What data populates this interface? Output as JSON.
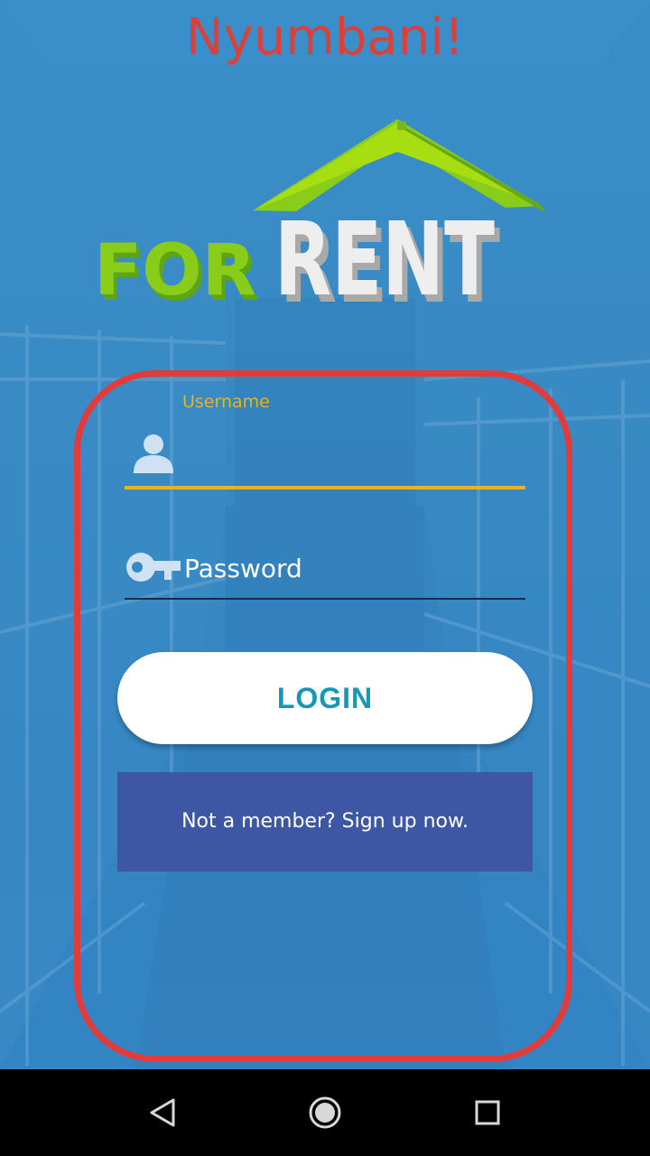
{
  "app": {
    "title": "Nyumbani!"
  },
  "logo": {
    "text_for": "FOR",
    "text_rent": "RENT"
  },
  "form": {
    "username_label": "Username",
    "username_value": "",
    "password_placeholder": "Password",
    "login_label": "LOGIN",
    "signup_label": "Not a member? Sign up now."
  },
  "navbar": {
    "back_icon": "back-triangle-icon",
    "home_icon": "home-circle-icon",
    "recents_icon": "recents-square-icon"
  },
  "colors": {
    "title": "#d9423a",
    "accent": "#e8b321",
    "login_text": "#1497b8",
    "signup_bg": "#3d57a4",
    "panel_border": "#e23b3b"
  }
}
